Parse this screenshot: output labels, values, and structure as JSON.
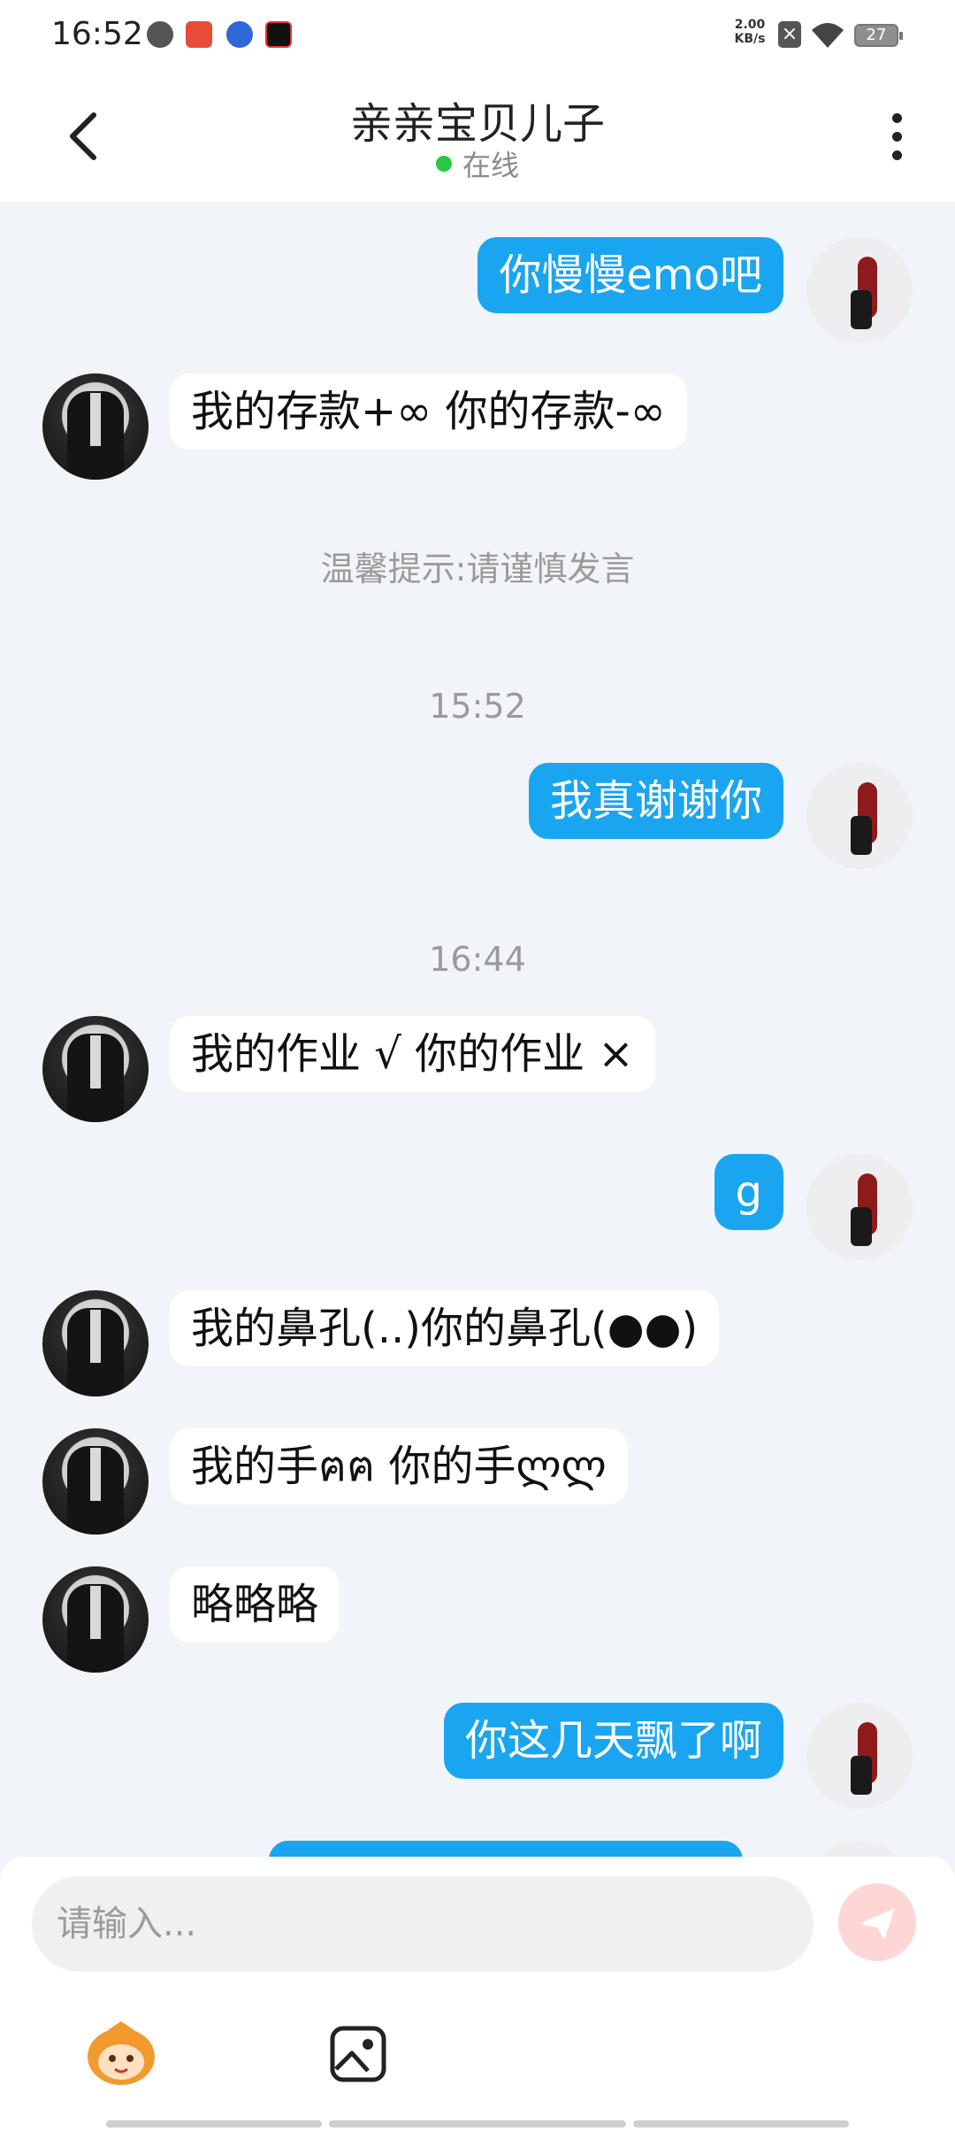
{
  "status_bar": {
    "time": "16:52",
    "network_speed_value": "2.00",
    "network_speed_unit": "KB/s",
    "battery": "27"
  },
  "header": {
    "title": "亲亲宝贝儿子",
    "status": "在线"
  },
  "messages": [
    {
      "from": "me",
      "text": "你慢慢emo吧"
    },
    {
      "from": "other",
      "text": "我的存款+∞ 你的存款-∞"
    },
    {
      "type": "notice",
      "text": "温馨提示:请谨慎发言"
    },
    {
      "type": "time",
      "text": "15:52"
    },
    {
      "from": "me",
      "text": "我真谢谢你"
    },
    {
      "type": "time",
      "text": "16:44"
    },
    {
      "from": "other",
      "text": "我的作业 √  你的作业 ×"
    },
    {
      "from": "me",
      "text": "g"
    },
    {
      "from": "other",
      "text": "我的鼻孔(..)你的鼻孔(●●)"
    },
    {
      "from": "other",
      "text": "我的手ฅฅ 你的手ლლ"
    },
    {
      "from": "other",
      "text": "略略略"
    },
    {
      "from": "me",
      "text": "你这几天飘了啊"
    }
  ],
  "input": {
    "placeholder": "请输入..."
  },
  "icons": {
    "back": "back-arrow-icon",
    "more": "more-vertical-icon",
    "send": "send-icon",
    "emoji": "emoji-mascot-icon",
    "image": "image-icon",
    "online_dot": "online-dot-icon"
  },
  "colors": {
    "my_bubble": "#1aa5f0",
    "other_bubble": "#ffffff",
    "chat_bg": "#f1f4f8",
    "online": "#28c840"
  }
}
